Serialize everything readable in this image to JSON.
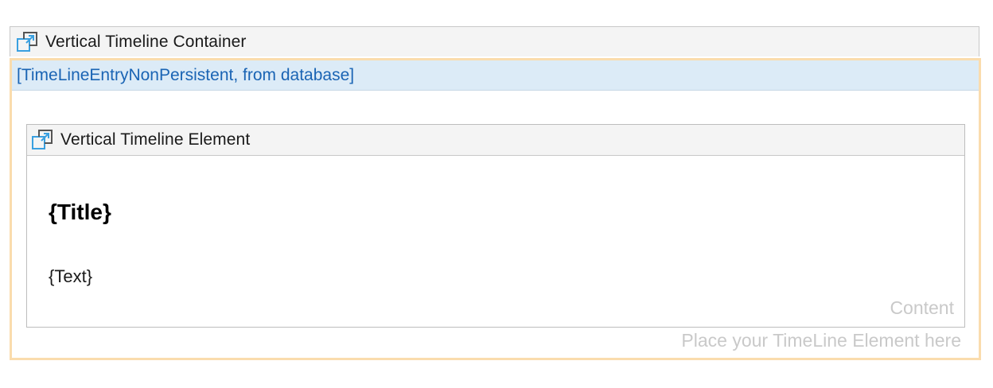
{
  "container": {
    "title": "Vertical Timeline Container",
    "icon": "widget-icon",
    "datasource": "[TimeLineEntryNonPersistent, from database]",
    "placeholder": "Place your TimeLine Element here",
    "border_color": "#fadcad"
  },
  "element": {
    "title": "Vertical Timeline Element",
    "icon": "widget-icon",
    "title_field": "{Title}",
    "text_field": "{Text}",
    "content_hint": "Content"
  },
  "colors": {
    "icon_blue": "#3aa0e0",
    "icon_dark": "#555555",
    "datasource_bg": "#dcebf7",
    "datasource_text": "#1a64b4"
  }
}
